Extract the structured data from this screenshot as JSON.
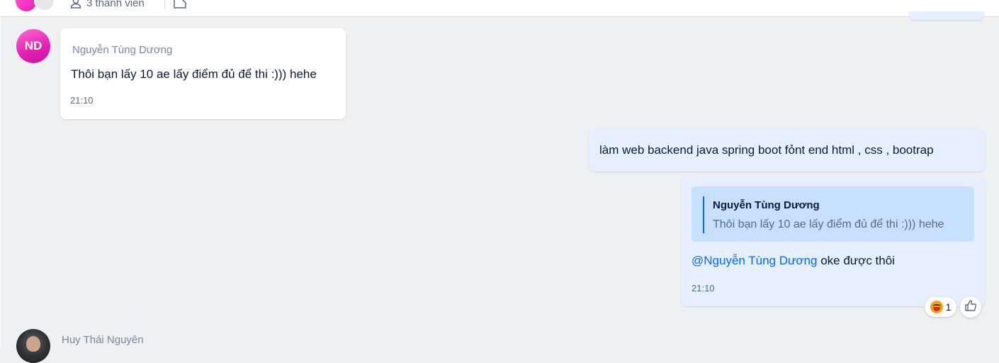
{
  "header": {
    "members_label": "3 thành viên",
    "icons": [
      "user-icon",
      "edit-icon"
    ]
  },
  "messages": [
    {
      "sender": "Nguyễn Tùng Dương",
      "avatar_initials": "ND",
      "text": "Thôi bạn lấy 10 ae lấy điểm đủ để thi :))) hehe",
      "time": "21:10"
    },
    {
      "outgoing": true,
      "text": "làm web backend java spring boot fỏnt end html , css , bootrap"
    },
    {
      "outgoing": true,
      "quote": {
        "sender": "Nguyễn Tùng Dương",
        "text": "Thôi bạn lấy 10 ae lấy điểm đủ để thi :))) hehe"
      },
      "mention": "@Nguyễn Tùng Dương",
      "text": "oke được thôi",
      "time": "21:10",
      "reaction": {
        "emoji": "laughing-emoji",
        "count": "1"
      }
    },
    {
      "sender": "Huy Thái Nguyên"
    }
  ],
  "colors": {
    "background": "#eef0f2",
    "incoming_bubble": "#ffffff",
    "outgoing_bubble": "#e5efff",
    "quote_bg": "#c7e0ff",
    "accent": "#0068ff"
  }
}
